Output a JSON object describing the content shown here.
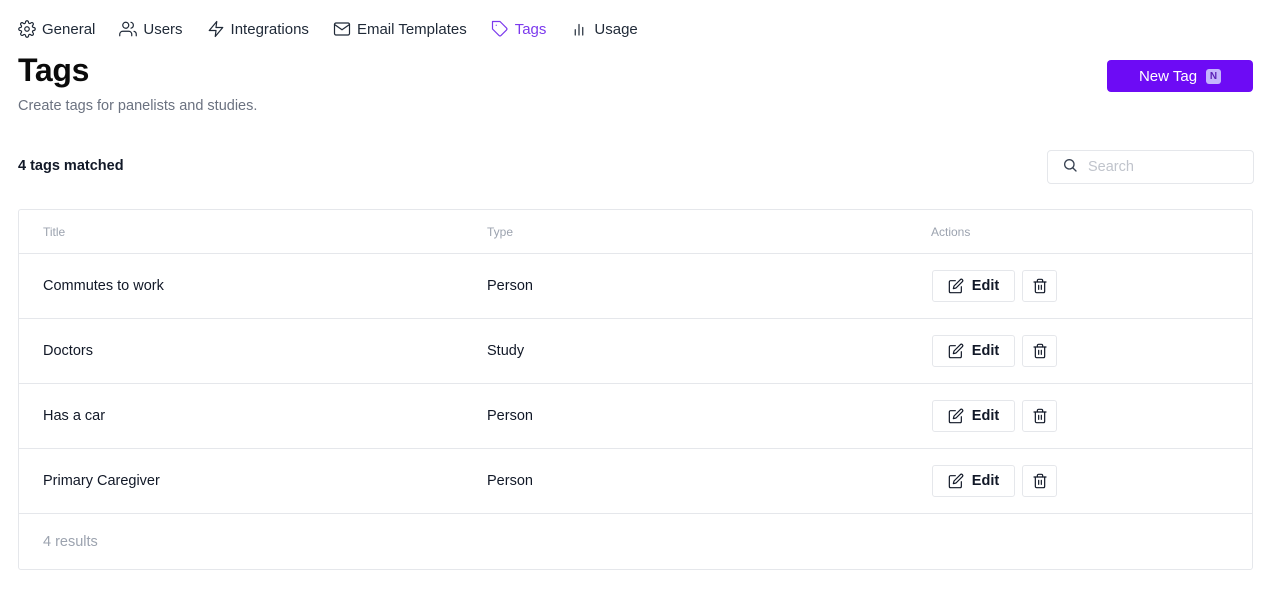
{
  "nav": {
    "items": [
      {
        "label": "General",
        "icon": "gear-icon",
        "active": false
      },
      {
        "label": "Users",
        "icon": "users-icon",
        "active": false
      },
      {
        "label": "Integrations",
        "icon": "lightning-icon",
        "active": false
      },
      {
        "label": "Email Templates",
        "icon": "envelope-icon",
        "active": false
      },
      {
        "label": "Tags",
        "icon": "tag-icon",
        "active": true
      },
      {
        "label": "Usage",
        "icon": "bar-chart-icon",
        "active": false
      }
    ]
  },
  "header": {
    "title": "Tags",
    "subtitle": "Create tags for panelists and studies.",
    "new_tag_label": "New Tag",
    "new_tag_shortcut": "N"
  },
  "summary": {
    "count_text": "4 tags matched"
  },
  "search": {
    "placeholder": "Search",
    "value": ""
  },
  "table": {
    "columns": [
      "Title",
      "Type",
      "Actions"
    ],
    "rows": [
      {
        "title": "Commutes to work",
        "type": "Person"
      },
      {
        "title": "Doctors",
        "type": "Study"
      },
      {
        "title": "Has a car",
        "type": "Person"
      },
      {
        "title": "Primary Caregiver",
        "type": "Person"
      }
    ],
    "edit_label": "Edit",
    "footer": "4 results"
  },
  "colors": {
    "accent": "#6d0bf5",
    "active_nav": "#7c3aed",
    "border": "#e5e7eb",
    "muted_text": "#6b7280"
  }
}
